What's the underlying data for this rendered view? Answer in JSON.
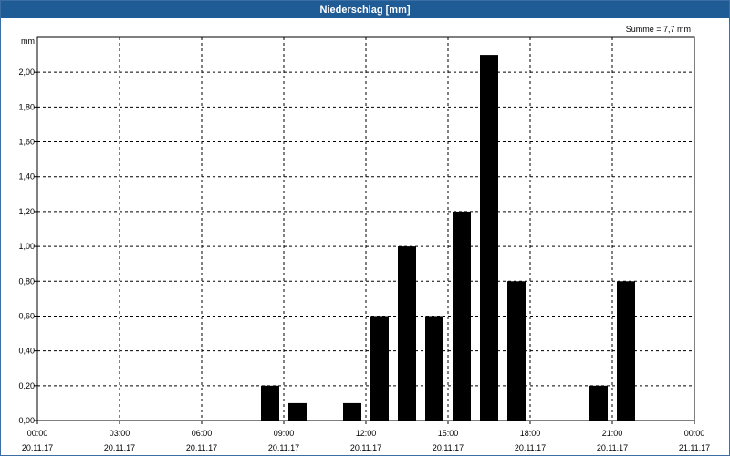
{
  "window": {
    "title": "Niederschlag [mm]"
  },
  "chart_data": {
    "type": "bar",
    "title": "Niederschlag [mm]",
    "annotation": "Summe = 7,7 mm",
    "ylabel": "mm",
    "xlabel": "",
    "ylim": [
      0,
      2.2
    ],
    "yticks": [
      "0,00",
      "0,20",
      "0,40",
      "0,60",
      "0,80",
      "1,00",
      "1,20",
      "1,40",
      "1,60",
      "1,80",
      "2,00"
    ],
    "xlim": [
      "20.11.17 00:00",
      "21.11.17 00:00"
    ],
    "xticks": [
      {
        "time": "00:00",
        "date": "20.11.17"
      },
      {
        "time": "03:00",
        "date": "20.11.17"
      },
      {
        "time": "06:00",
        "date": "20.11.17"
      },
      {
        "time": "09:00",
        "date": "20.11.17"
      },
      {
        "time": "12:00",
        "date": "20.11.17"
      },
      {
        "time": "15:00",
        "date": "20.11.17"
      },
      {
        "time": "18:00",
        "date": "20.11.17"
      },
      {
        "time": "21:00",
        "date": "20.11.17"
      },
      {
        "time": "00:00",
        "date": "21.11.17"
      }
    ],
    "grid": true,
    "bar_color": "#000000",
    "categories": [
      "08:00",
      "09:00",
      "11:00",
      "12:00",
      "13:00",
      "14:00",
      "15:00",
      "16:00",
      "17:00",
      "20:00",
      "21:00"
    ],
    "values": [
      0.2,
      0.1,
      0.1,
      0.6,
      1.0,
      0.6,
      1.2,
      2.1,
      0.8,
      0.2,
      0.8
    ]
  }
}
